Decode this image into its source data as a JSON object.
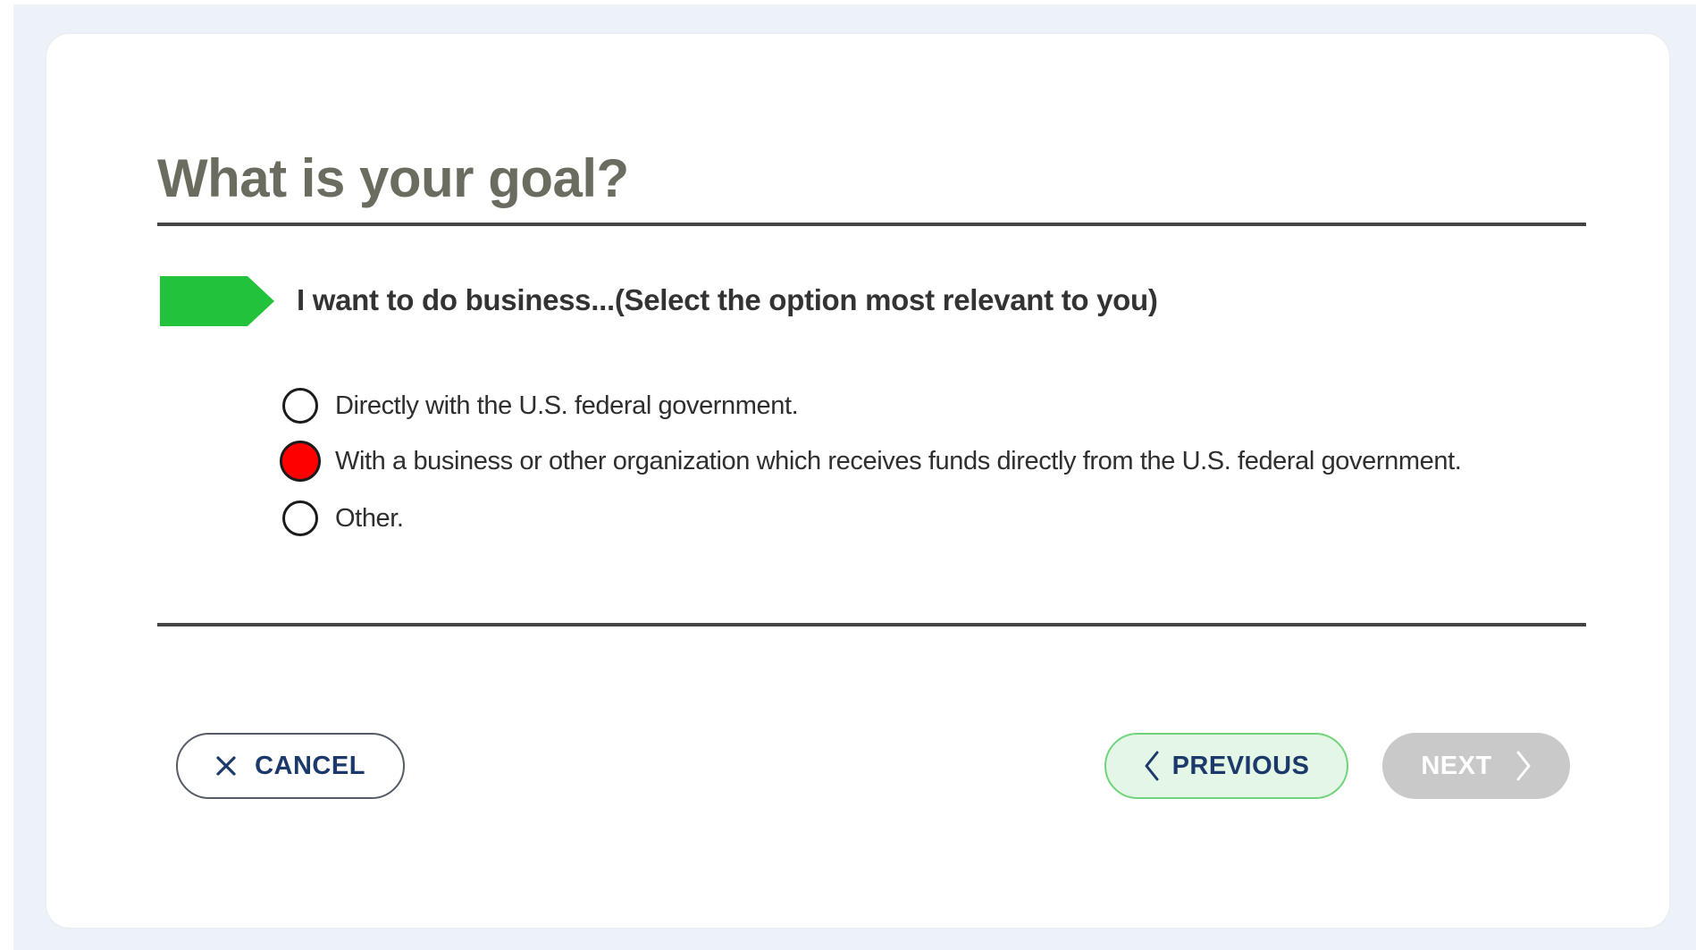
{
  "page": {
    "title": "What is your goal?"
  },
  "question": {
    "text": "I want to do business...(Select the option most relevant to you)",
    "marker_color": "#22c33b"
  },
  "options": [
    {
      "label": "Directly with the U.S. federal government.",
      "selected": false
    },
    {
      "label": "With a business or other organization which receives funds directly from the U.S. federal government.",
      "selected": true
    },
    {
      "label": "Other.",
      "selected": false
    }
  ],
  "buttons": {
    "cancel": {
      "label": "CANCEL",
      "icon": "close-icon"
    },
    "previous": {
      "label": "PREVIOUS",
      "icon": "chevron-left-icon"
    },
    "next": {
      "label": "NEXT",
      "icon": "chevron-right-icon",
      "disabled": true
    }
  },
  "colors": {
    "selected_radio": "#ff0000",
    "title": "#6b6b60",
    "button_text": "#1b3a6b",
    "previous_border": "#6fd47a",
    "next_disabled": "#c9c9c9"
  }
}
